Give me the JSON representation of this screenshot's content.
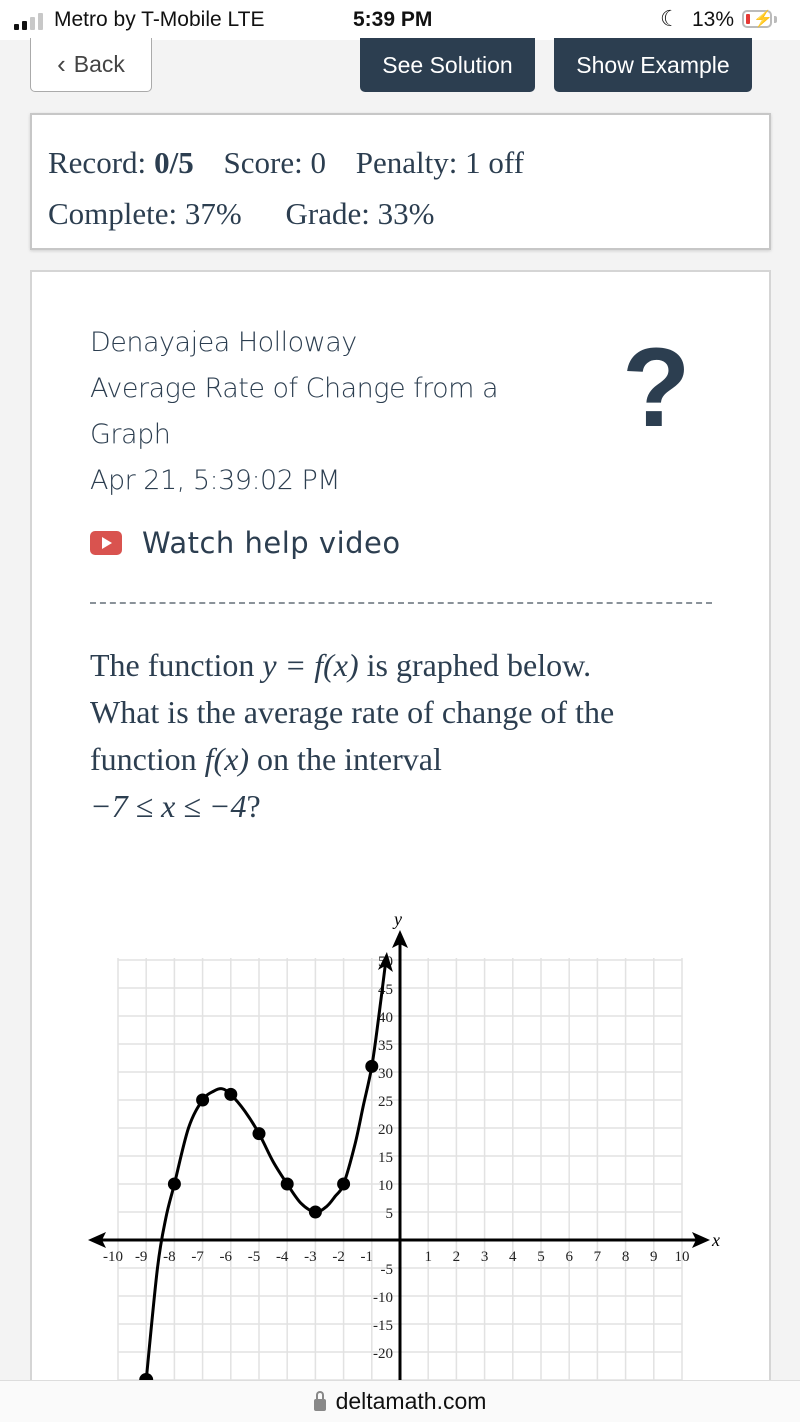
{
  "status_bar": {
    "carrier": "Metro by T-Mobile  LTE",
    "time": "5:39 PM",
    "battery": "13%",
    "signal_bars": 2,
    "signal_total": 4,
    "icons": [
      "signal-icon",
      "moon-icon",
      "battery-charging-icon"
    ]
  },
  "toolbar": {
    "back_label": "Back",
    "see_solution_label": "See Solution",
    "show_example_label": "Show Example"
  },
  "record": {
    "record_label": "Record:",
    "record_value": "0/5",
    "score": "Score: 0",
    "penalty": "Penalty: 1 off",
    "complete": "Complete: 37%",
    "grade": "Grade: 33%"
  },
  "problem": {
    "student_name": "Denayajea Holloway",
    "title_line1": "Average Rate of Change from a",
    "title_line2": "Graph",
    "timestamp": "Apr 21, 5:39:02 PM",
    "help_icon": "?",
    "video_link": "Watch help video",
    "question": {
      "line1_a": "The function ",
      "line1_math": "y = f(x)",
      "line1_b": " is graphed below.",
      "line2": "What is the average rate of change of the",
      "line3_a": "function ",
      "line3_math": "f(x)",
      "line3_b": " on the interval",
      "line4_math": "−7 ≤ x ≤ −4",
      "line4_end": "?"
    }
  },
  "chart_data": {
    "type": "line",
    "title": "",
    "xlabel": "x",
    "ylabel": "y",
    "xlim": [
      -10,
      10
    ],
    "ylim": [
      -25,
      50
    ],
    "grid": true,
    "x_ticks": [
      -10,
      -9,
      -8,
      -7,
      -6,
      -5,
      -4,
      -3,
      -2,
      -1,
      1,
      2,
      3,
      4,
      5,
      6,
      7,
      8,
      9,
      10
    ],
    "y_ticks": [
      50,
      45,
      40,
      35,
      30,
      25,
      20,
      15,
      10,
      5,
      -5,
      -10,
      -15,
      -20
    ],
    "points": [
      {
        "x": -8,
        "y": 10
      },
      {
        "x": -7,
        "y": 25
      },
      {
        "x": -6,
        "y": 26
      },
      {
        "x": -5,
        "y": 19
      },
      {
        "x": -4,
        "y": 10
      },
      {
        "x": -3,
        "y": 5
      },
      {
        "x": -2,
        "y": 10
      },
      {
        "x": -1,
        "y": 31
      }
    ],
    "curve": [
      [
        -9,
        -25
      ],
      [
        -8.6,
        -5
      ],
      [
        -8.3,
        4
      ],
      [
        -8,
        10
      ],
      [
        -7.5,
        20
      ],
      [
        -7,
        25
      ],
      [
        -6.6,
        26.6
      ],
      [
        -6.3,
        27
      ],
      [
        -6,
        26
      ],
      [
        -5.5,
        23
      ],
      [
        -5,
        19
      ],
      [
        -4.5,
        14
      ],
      [
        -4,
        10
      ],
      [
        -3.5,
        6.5
      ],
      [
        -3,
        5
      ],
      [
        -2.6,
        6
      ],
      [
        -2.3,
        7.8
      ],
      [
        -2,
        10
      ],
      [
        -1.6,
        17
      ],
      [
        -1.3,
        24
      ],
      [
        -1,
        31
      ],
      [
        -0.75,
        40
      ],
      [
        -0.5,
        50
      ]
    ]
  },
  "url_bar": {
    "domain": "deltamath.com"
  }
}
